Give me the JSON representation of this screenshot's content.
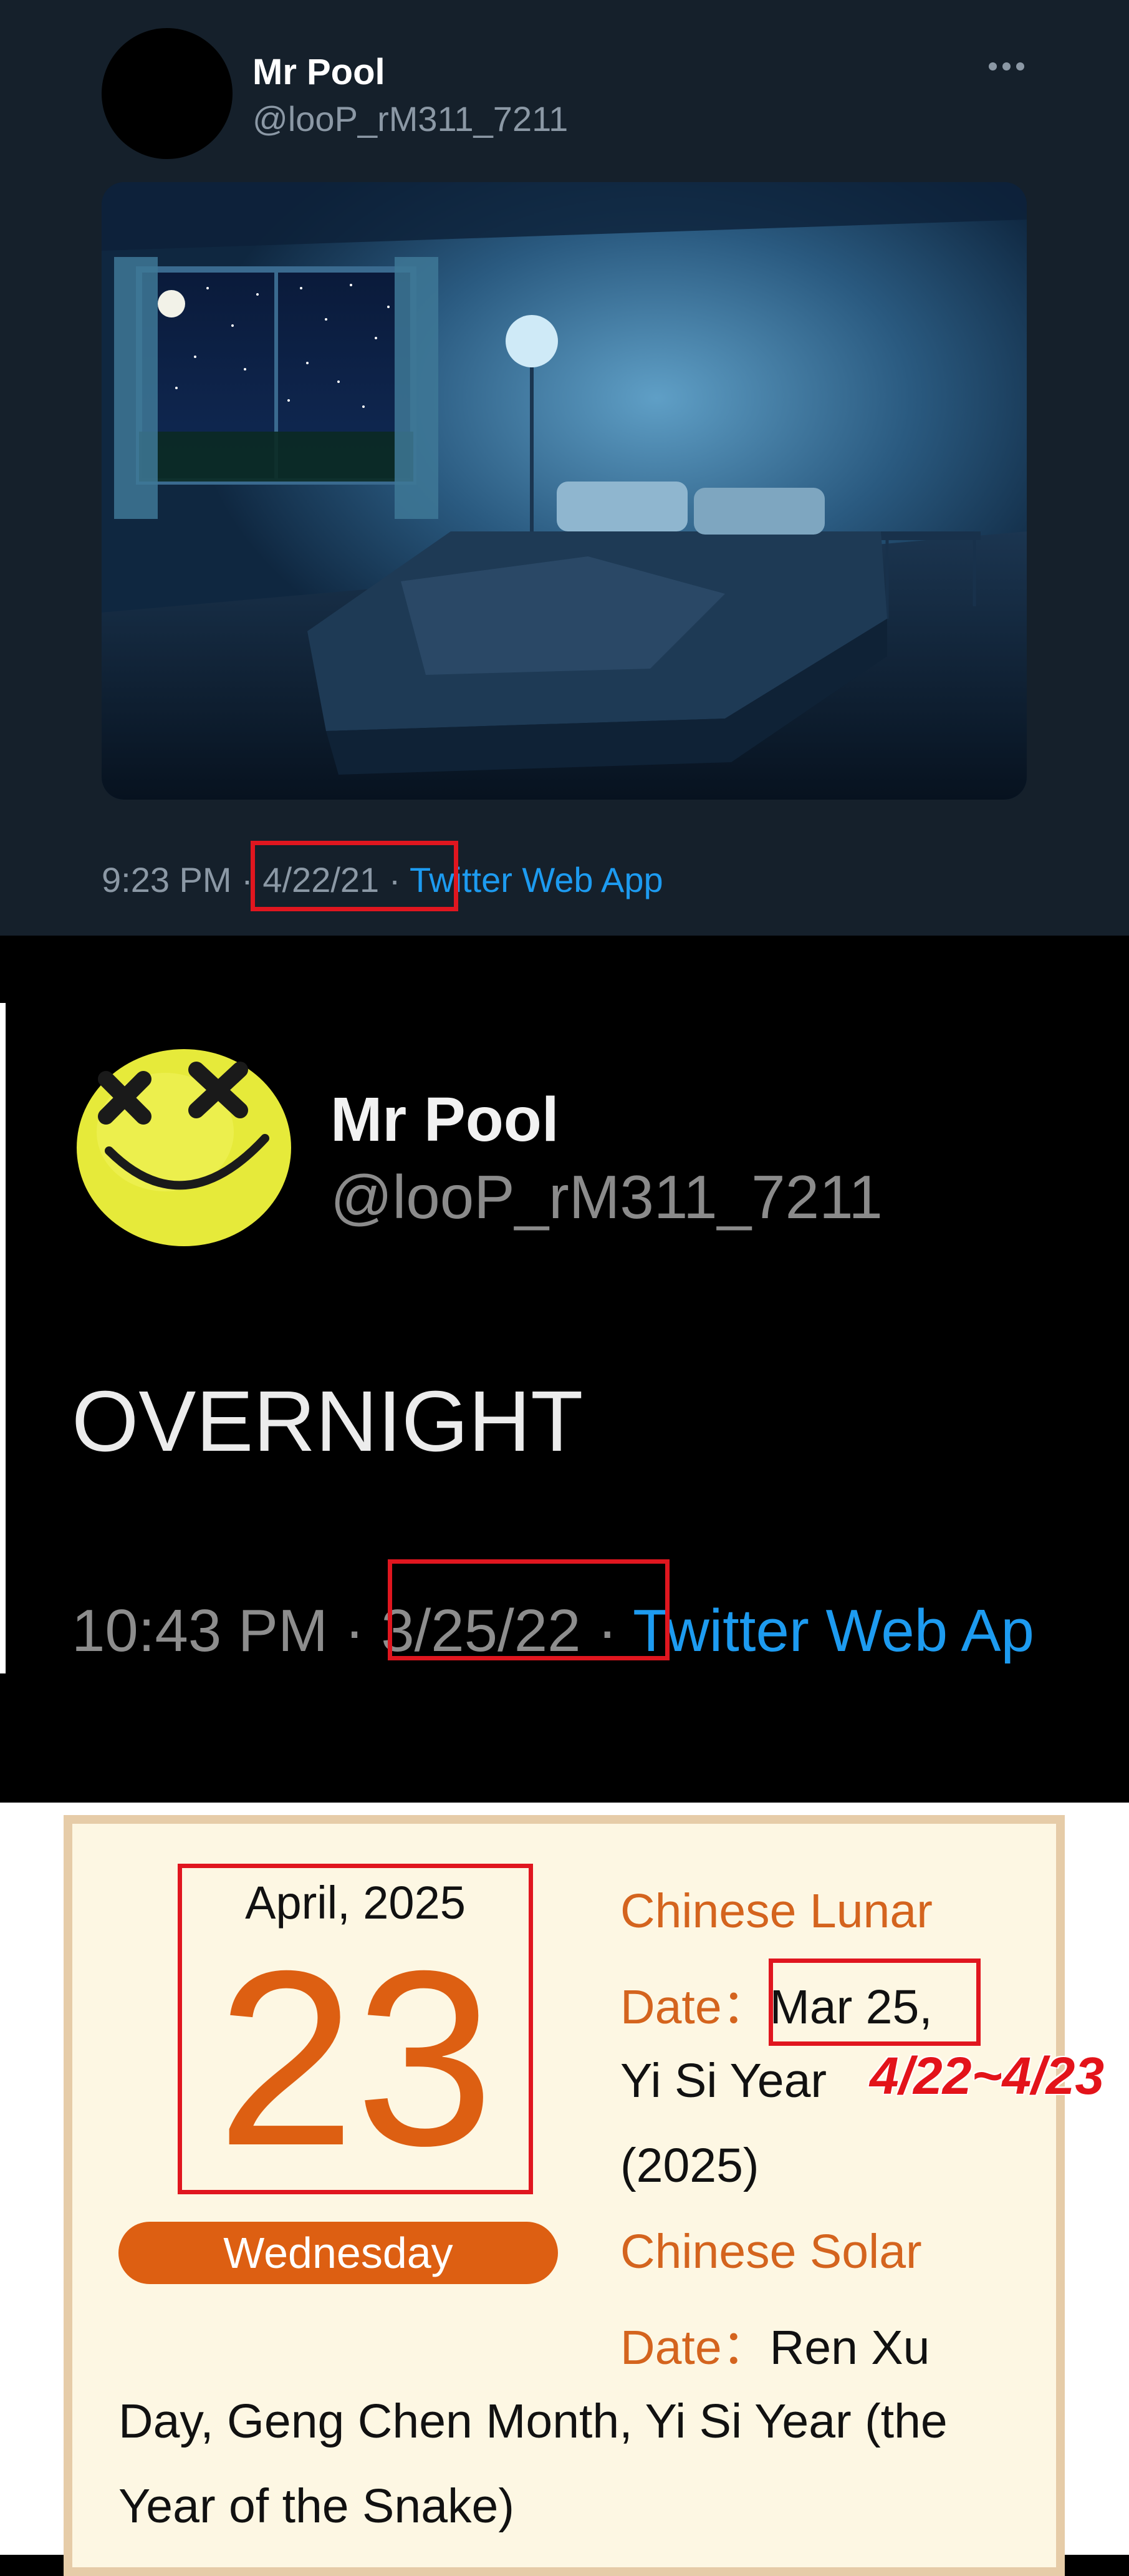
{
  "panel1": {
    "display_name": "Mr Pool",
    "handle": "@looP_rM311_7211",
    "media_description": "dark night bedroom",
    "time": "9:23 PM",
    "separator": "·",
    "date": "4/22/21",
    "source": "Twitter Web App"
  },
  "panel2": {
    "display_name": "Mr Pool",
    "handle": "@looP_rM311_7211",
    "tweet_text": "OVERNIGHT",
    "time": "10:43 PM",
    "separator": "·",
    "date": "3/25/22",
    "source": "Twitter Web Ap"
  },
  "panel3": {
    "month_year": "April, 2025",
    "day": "23",
    "weekday": "Wednesday",
    "lunar_label_1": "Chinese Lunar",
    "lunar_label_2": "Date：",
    "lunar_date": "Mar 25,",
    "lunar_year": "Yi Si Year",
    "lunar_year_num": "(2025)",
    "overlay_annotation": "4/22~4/23",
    "solar_label_1": "Chinese Solar",
    "solar_label_2": "Date：",
    "solar_value_1": "Ren Xu",
    "solar_value_2": "Day, Geng Chen Month, Yi Si Year (the",
    "solar_value_3": "Year of the Snake)"
  },
  "colors": {
    "twitter_dim_bg": "#15202b",
    "link_blue": "#1d9bf0",
    "highlight_red": "#e0161f",
    "calendar_orange": "#dd5f12",
    "calendar_bg": "#fdf7e3"
  }
}
